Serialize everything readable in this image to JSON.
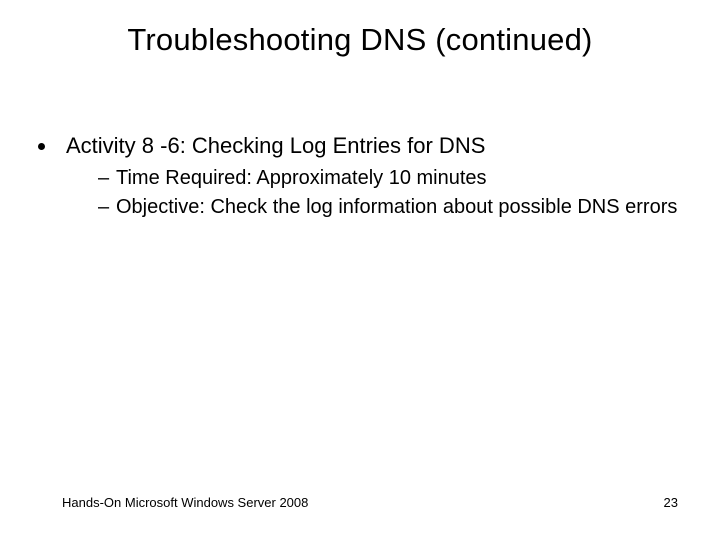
{
  "slide": {
    "title": "Troubleshooting DNS (continued)",
    "bullets": {
      "item1": {
        "text": "Activity 8 -6: Checking Log Entries for DNS",
        "sub": {
          "a": "Time Required: Approximately 10 minutes",
          "b": "Objective: Check the log information about possible DNS errors"
        }
      }
    },
    "footer": {
      "left": "Hands-On Microsoft Windows Server 2008",
      "page": "23"
    }
  }
}
